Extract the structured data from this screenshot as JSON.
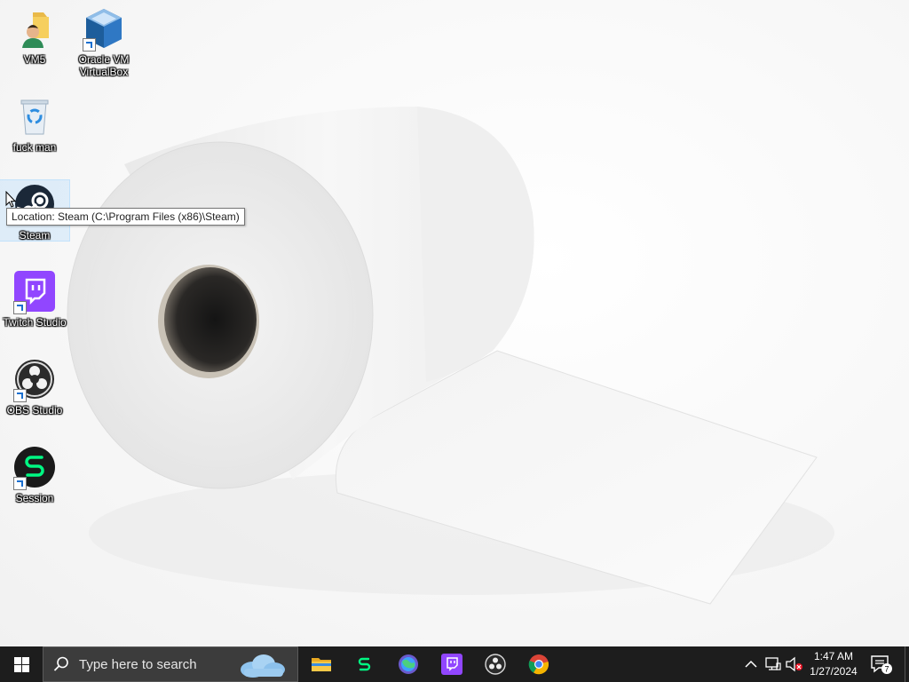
{
  "desktop": {
    "icons": [
      {
        "label": "VM5",
        "icon": "folder-user-icon"
      },
      {
        "label": "Oracle VM VirtualBox",
        "icon": "virtualbox-icon"
      },
      {
        "label": "fuck man",
        "icon": "recycle-bin-icon"
      },
      {
        "label": "Steam",
        "icon": "steam-icon"
      },
      {
        "label": "Twitch Studio",
        "icon": "twitch-icon"
      },
      {
        "label": "OBS Studio",
        "icon": "obs-icon"
      },
      {
        "label": "Session",
        "icon": "session-icon"
      }
    ],
    "tooltip": "Location: Steam (C:\\Program Files (x86)\\Steam)"
  },
  "taskbar": {
    "search_placeholder": "Type here to search",
    "pinned": [
      "file-explorer-icon",
      "session-icon",
      "browser-icon",
      "twitch-icon",
      "obs-icon",
      "chrome-icon"
    ],
    "clock_time": "1:47 AM",
    "clock_date": "1/27/2024",
    "notification_count": "7"
  },
  "colors": {
    "taskbar": "#1d1d1d",
    "search_box": "#3c3c3c",
    "twitch": "#9146ff",
    "session": "#00f782",
    "accent_blue": "#0078d7"
  }
}
